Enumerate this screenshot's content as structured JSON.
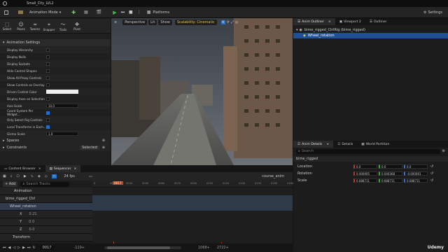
{
  "window": {
    "title": "Small_City_LVL2",
    "mode": "Animation Mode",
    "platforms": "Platforms",
    "settings": "Settings"
  },
  "modes": [
    "Select",
    "Poses",
    "Tweens",
    "Snapper",
    "Trails",
    "Pivot"
  ],
  "animation_settings": {
    "header": "Animation Settings",
    "props": [
      {
        "label": "Display Hierarchy",
        "type": "check",
        "on": false
      },
      {
        "label": "Display Nulls",
        "type": "check",
        "on": false
      },
      {
        "label": "Display Sockets",
        "type": "check",
        "on": false
      },
      {
        "label": "Hide Control Shapes",
        "type": "check",
        "on": false
      },
      {
        "label": "Show All Proxy Controls",
        "type": "check",
        "on": false
      },
      {
        "label": "Show Controls as Overlay",
        "type": "check",
        "on": false
      },
      {
        "label": "Driven Control Color",
        "type": "color"
      },
      {
        "label": "Display Axes on Selection",
        "type": "check",
        "on": false
      },
      {
        "label": "Axis Scale",
        "type": "num",
        "value": "10.0"
      },
      {
        "label": "Coord System Per Widget...",
        "type": "check",
        "on": true
      },
      {
        "label": "Only Select Rig Controls",
        "type": "check",
        "on": false
      },
      {
        "label": "Local Transforms in Each...",
        "type": "check",
        "on": true
      },
      {
        "label": "Gizmo Scale",
        "type": "num",
        "value": "1.0"
      }
    ],
    "spaces": "Spaces",
    "constraints": "Constraints",
    "constraints_value": "Selected"
  },
  "viewport": {
    "perspective": "Perspective",
    "lit": "Lit",
    "show": "Show",
    "scalability": "Scalability: Cinematic"
  },
  "outliner": {
    "tabs": [
      "Anim Outliner",
      "Viewport 2",
      "Outliner"
    ],
    "items": [
      "bime_rigged_CtrlRig (bime_rigged)",
      "Wheel_rotation"
    ]
  },
  "details": {
    "tabs": [
      "Anim Details",
      "Details",
      "World Partition"
    ],
    "search_placeholder": "Search",
    "group": "bime_rigged",
    "rows": [
      {
        "label": "Location",
        "values": [
          "0.0",
          "0.0",
          "0.0"
        ]
      },
      {
        "label": "Rotation",
        "values": [
          "0.000005",
          "0.040368",
          "-0.000001"
        ]
      },
      {
        "label": "Scale",
        "values": [
          "0.688711",
          "0.688711",
          "0.688711"
        ]
      }
    ]
  },
  "bottom": {
    "tabs": [
      "Content Browser",
      "Sequencer"
    ],
    "add": "+ Add",
    "search_placeholder": "Search Tracks",
    "fps": "24 fps",
    "seq_name": "course_anim",
    "tracks": [
      {
        "label": "Animation",
        "indent": 20
      },
      {
        "label": "bime_rigged_Ctrl",
        "indent": 8
      },
      {
        "label": "Wheel_rotation",
        "indent": 14
      },
      {
        "label": "X",
        "indent": 28,
        "value": "0.21"
      },
      {
        "label": "Y",
        "indent": 28,
        "value": "0.0"
      },
      {
        "label": "Z",
        "indent": 28,
        "value": "0.0"
      },
      {
        "label": "Transform",
        "indent": 18
      }
    ],
    "ruler": [
      "0",
      "0015",
      "0030",
      "0045",
      "0060",
      "0075",
      "0090",
      "0105",
      "0120",
      "0135",
      "0150",
      "0165",
      "0180"
    ],
    "playhead": "0017",
    "current": "0017",
    "start": "-119+",
    "end": "3720+",
    "range_a": "1068+",
    "range_b": "2722+"
  },
  "watermark": "Udemy"
}
